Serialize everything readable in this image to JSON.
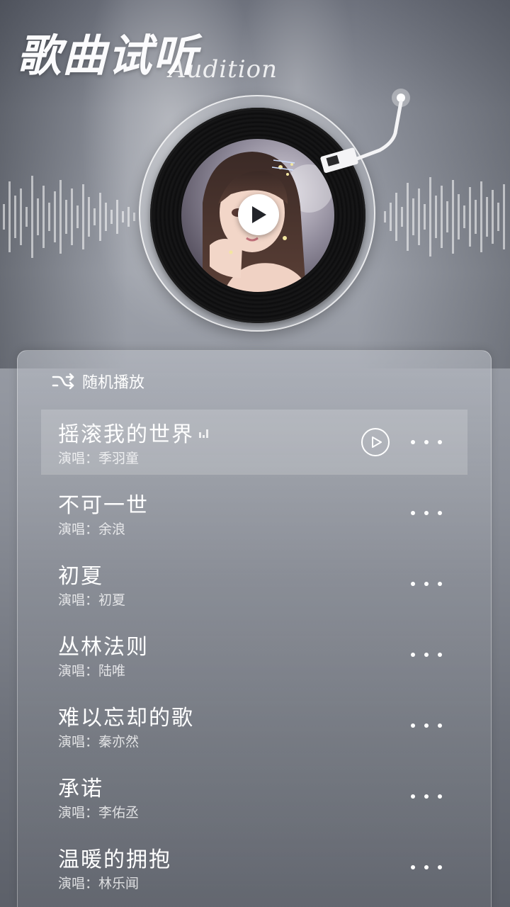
{
  "header": {
    "title": "歌曲试听",
    "subtitle": "Audition"
  },
  "player": {
    "play_icon": "play-icon",
    "artwork": "anime-girl-portrait",
    "state": "paused"
  },
  "playlist": {
    "shuffle_icon": "shuffle-icon",
    "shuffle_label": "随机播放",
    "active_index": 0,
    "songs": [
      {
        "title": "摇滚我的世界",
        "artist": "演唱：季羽童"
      },
      {
        "title": "不可一世",
        "artist": "演唱：余浪"
      },
      {
        "title": "初夏",
        "artist": "演唱：初夏"
      },
      {
        "title": "丛林法则",
        "artist": "演唱：陆唯"
      },
      {
        "title": "难以忘却的歌",
        "artist": "演唱：秦亦然"
      },
      {
        "title": "承诺",
        "artist": "演唱：李佑丞"
      },
      {
        "title": "温暖的拥抱",
        "artist": "演唱：林乐闻"
      }
    ]
  },
  "colors": {
    "accent": "#ffffff",
    "disc": "#111112",
    "background": "#8d919b"
  }
}
